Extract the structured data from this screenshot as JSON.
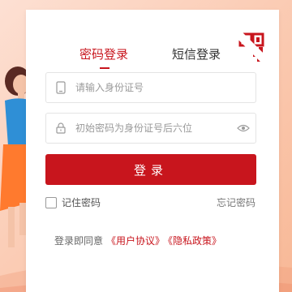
{
  "tabs": [
    {
      "label": "密码登录",
      "active": true
    },
    {
      "label": "短信登录",
      "active": false
    }
  ],
  "fields": {
    "id_number": {
      "placeholder": "请输入身份证号",
      "value": ""
    },
    "password": {
      "placeholder": "初始密码为身份证号后六位",
      "value": ""
    }
  },
  "login_label": "登录",
  "remember_label": "记住密码",
  "forgot_label": "忘记密码",
  "agreement": {
    "prefix": "登录即同意",
    "user_agreement": "《用户协议》",
    "privacy_policy": "《隐私政策》"
  },
  "colors": {
    "accent": "#c8151d",
    "background": "#fbcdb6"
  },
  "icons": [
    "qr-code-icon",
    "phone-icon",
    "lock-icon",
    "eye-icon"
  ]
}
